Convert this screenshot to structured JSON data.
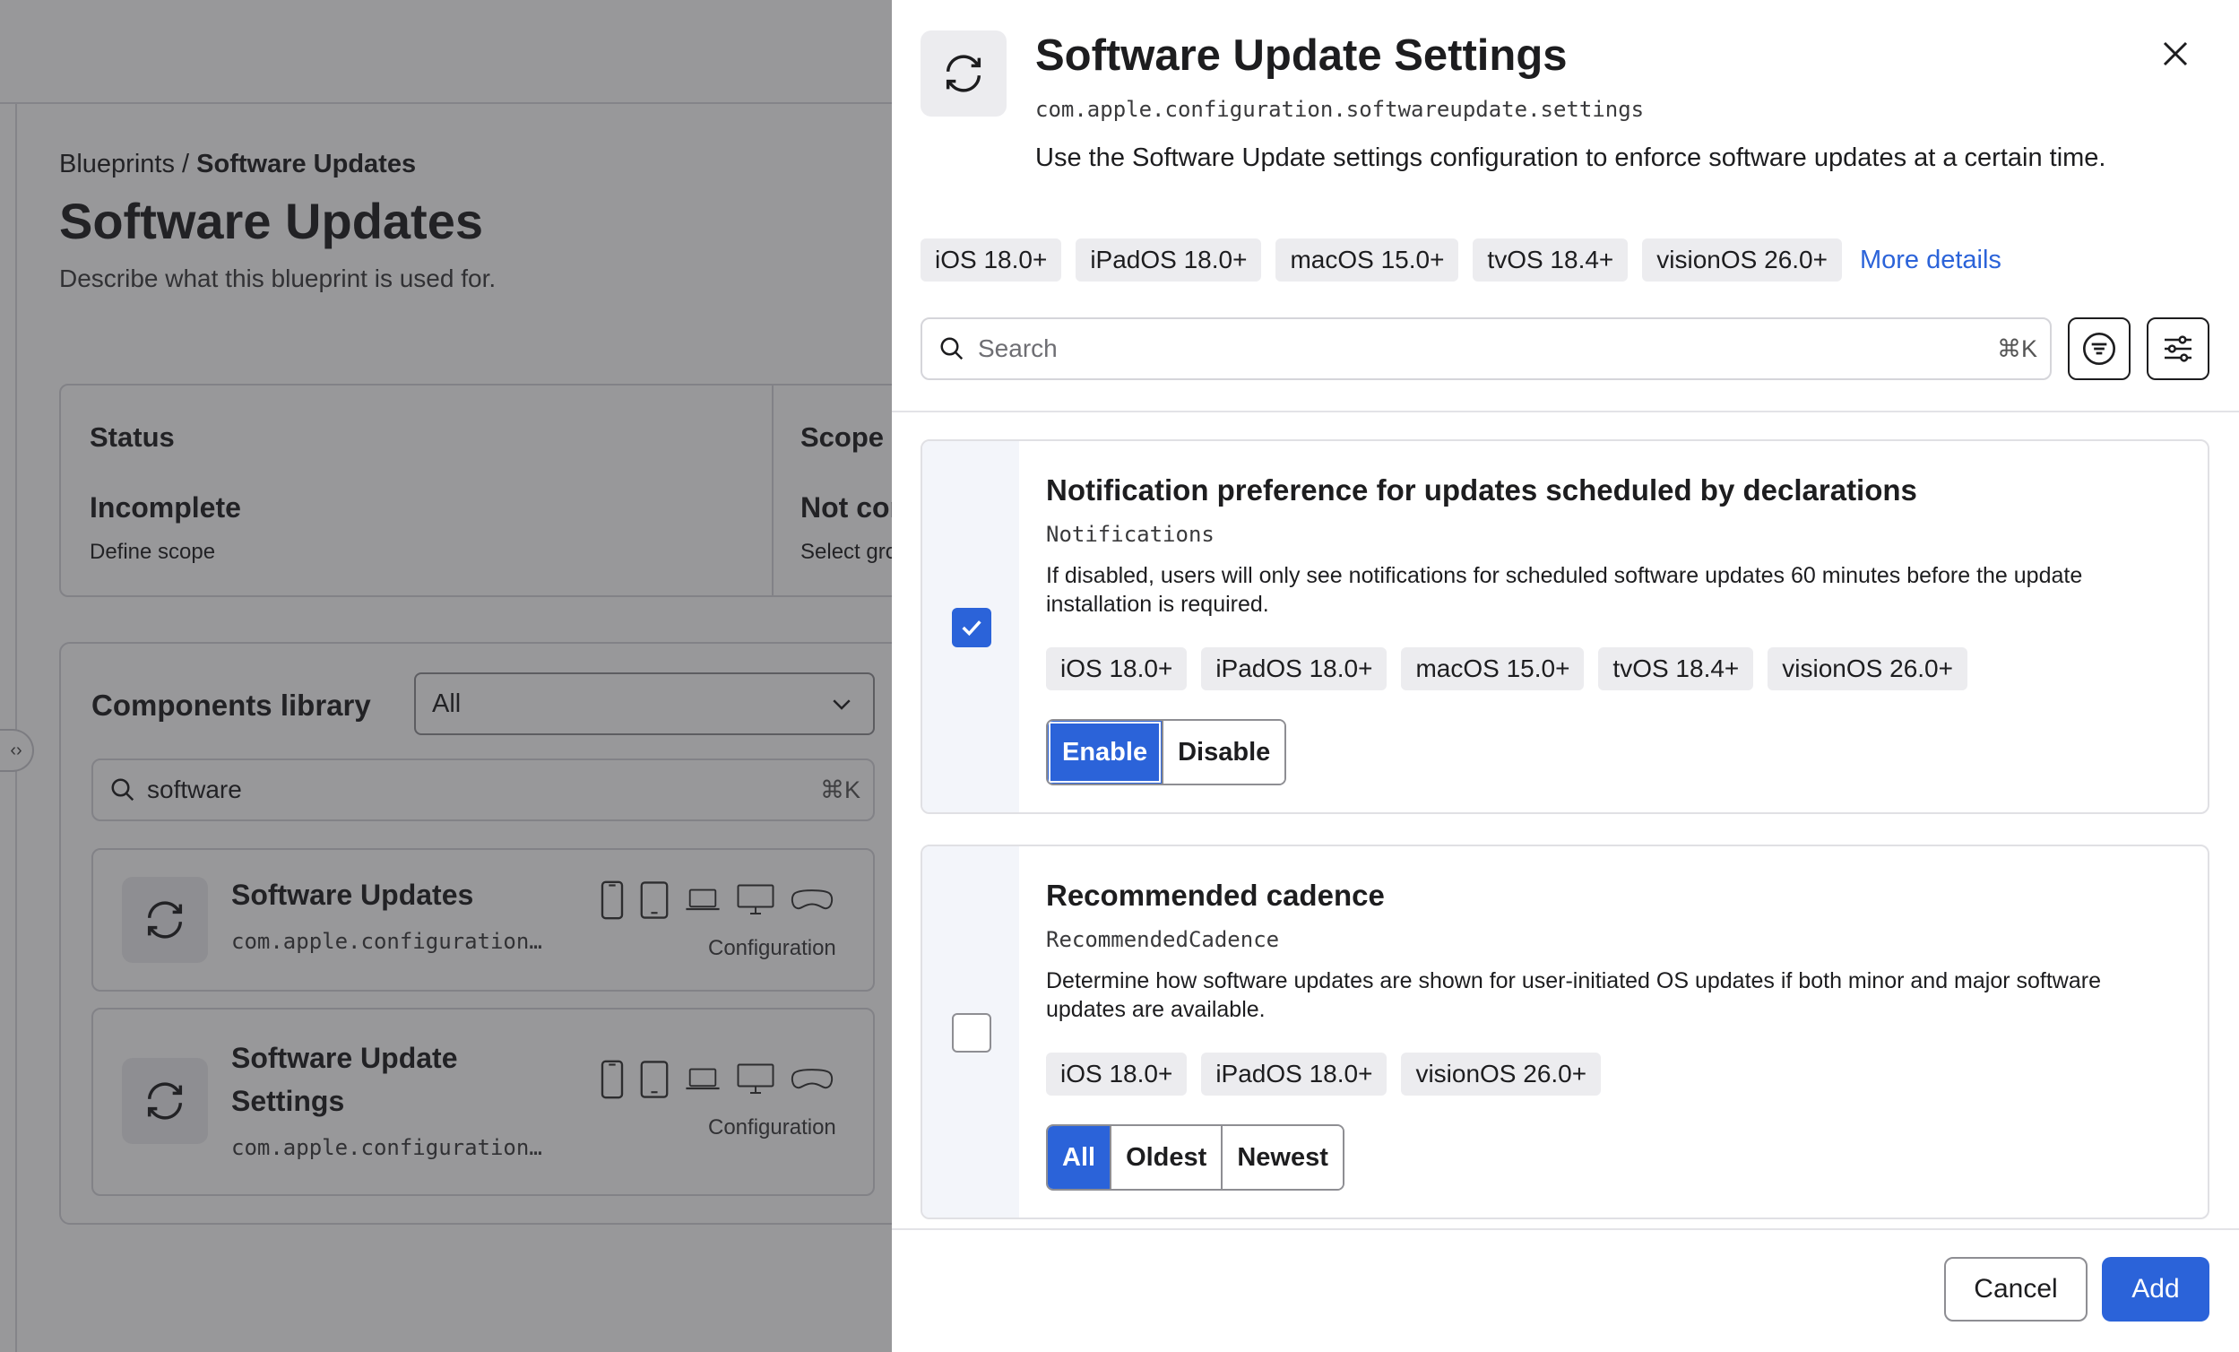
{
  "background": {
    "breadcrumb": {
      "parent": "Blueprints",
      "separator": " / ",
      "current": "Software Updates"
    },
    "title": "Software Updates",
    "description": "Describe what this blueprint is used for.",
    "status": {
      "heading": "Status",
      "value": "Incomplete",
      "sub": "Define scope"
    },
    "scope": {
      "heading": "Scope",
      "value": "Not configured",
      "sub": "Select groups"
    },
    "library": {
      "title": "Components library",
      "filter_value": "All",
      "search_value": "software",
      "search_shortcut": "⌘K",
      "items": [
        {
          "name": "Software Updates",
          "id": "com.apple.configuration…",
          "kind": "Configuration"
        },
        {
          "name": "Software Update Settings",
          "id": "com.apple.configuration…",
          "kind": "Configuration"
        }
      ]
    }
  },
  "drawer": {
    "title": "Software Update Settings",
    "identifier": "com.apple.configuration.softwareupdate.settings",
    "description": "Use the Software Update settings configuration to enforce software updates at a certain time.",
    "platforms": [
      "iOS 18.0+",
      "iPadOS 18.0+",
      "macOS 15.0+",
      "tvOS 18.4+",
      "visionOS 26.0+"
    ],
    "more_details": "More details",
    "search": {
      "placeholder": "Search",
      "shortcut": "⌘K"
    },
    "settings": [
      {
        "title": "Notification preference for updates scheduled by declarations",
        "key": "Notifications",
        "description": "If disabled, users will only see notifications for scheduled software updates 60 minutes before the update installation is required.",
        "platforms": [
          "iOS 18.0+",
          "iPadOS 18.0+",
          "macOS 15.0+",
          "tvOS 18.4+",
          "visionOS 26.0+"
        ],
        "checked": true,
        "options": [
          "Enable",
          "Disable"
        ],
        "selected": "Enable"
      },
      {
        "title": "Recommended cadence",
        "key": "RecommendedCadence",
        "description": "Determine how software updates are shown for user-initiated OS updates if both minor and major software updates are available.",
        "platforms": [
          "iOS 18.0+",
          "iPadOS 18.0+",
          "visionOS 26.0+"
        ],
        "checked": false,
        "options": [
          "All",
          "Oldest",
          "Newest"
        ],
        "selected": "All"
      }
    ],
    "cancel_label": "Cancel",
    "add_label": "Add"
  },
  "colors": {
    "accent": "#2b63d9",
    "chip_bg": "#ececef",
    "gutter_bg": "#f3f5fa"
  }
}
